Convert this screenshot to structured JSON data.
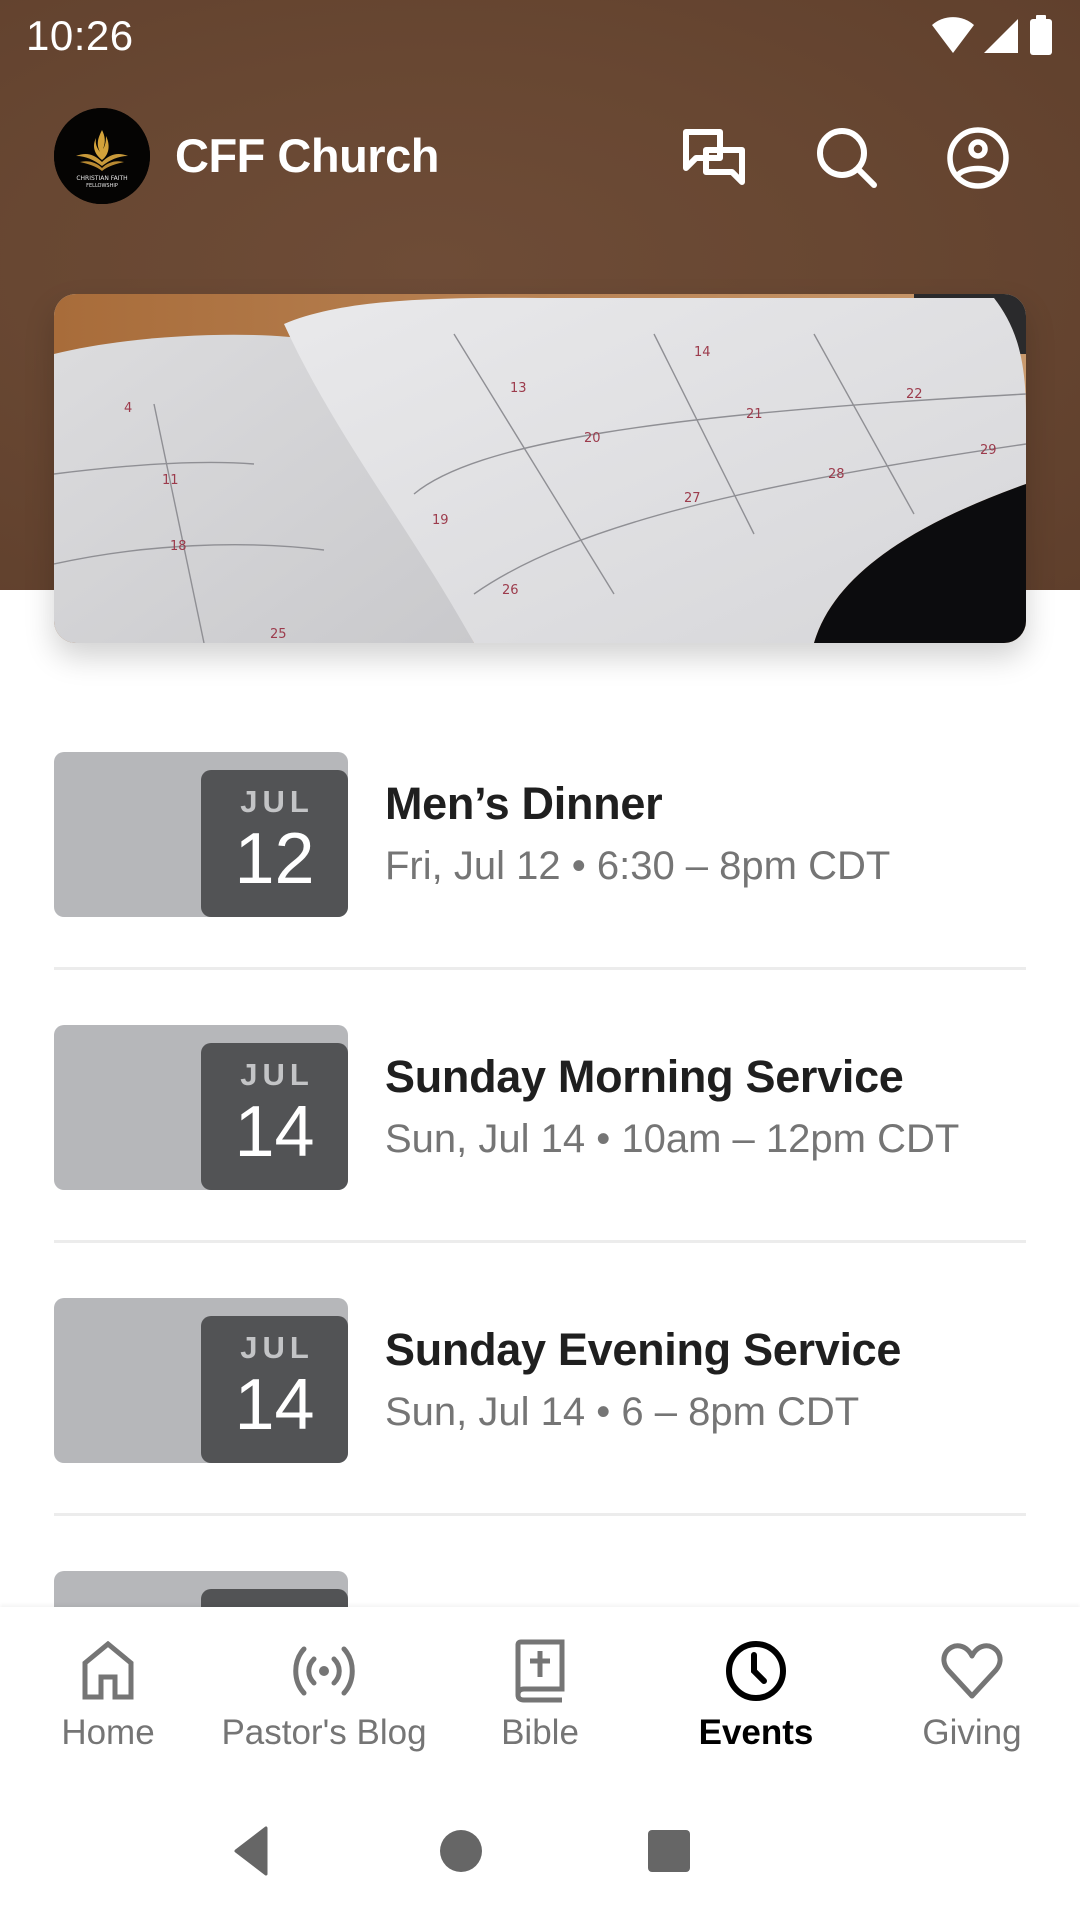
{
  "status_bar": {
    "time": "10:26",
    "icons": [
      "wifi-icon",
      "cellular-signal-icon",
      "battery-icon"
    ]
  },
  "app_bar": {
    "logo": {
      "icon": "christian-faith-fellowship-logo",
      "text_line1": "CHRISTIAN FAITH",
      "text_line2": "FELLOWSHIP"
    },
    "title": "CFF Church",
    "actions": [
      {
        "name": "chat",
        "icon": "chat-bubbles-icon"
      },
      {
        "name": "search",
        "icon": "search-icon"
      },
      {
        "name": "account",
        "icon": "account-circle-icon"
      }
    ]
  },
  "hero": {
    "description": "Open calendar planner book",
    "calendar_numbers": [
      "4",
      "11",
      "18",
      "25",
      "13",
      "20",
      "27",
      "14",
      "21",
      "28",
      "22",
      "29",
      "19",
      "26"
    ]
  },
  "events": [
    {
      "month": "JUL",
      "day": "12",
      "title": "Men’s Dinner",
      "time": "Fri, Jul 12 • 6:30 – 8pm CDT"
    },
    {
      "month": "JUL",
      "day": "14",
      "title": "Sunday Morning Service",
      "time": "Sun, Jul 14 • 10am – 12pm CDT"
    },
    {
      "month": "JUL",
      "day": "14",
      "title": "Sunday Evening Service",
      "time": "Sun, Jul 14 • 6 – 8pm CDT"
    }
  ],
  "bottom_nav": {
    "items": [
      {
        "label": "Home",
        "icon": "home-icon",
        "active": false
      },
      {
        "label": "Pastor's Blog",
        "icon": "broadcast-icon",
        "active": false
      },
      {
        "label": "Bible",
        "icon": "bible-icon",
        "active": false
      },
      {
        "label": "Events",
        "icon": "clock-icon",
        "active": true
      },
      {
        "label": "Giving",
        "icon": "heart-icon",
        "active": false
      }
    ]
  },
  "system_nav": {
    "buttons": [
      "back",
      "home",
      "recents"
    ]
  },
  "colors": {
    "header_brown": "#684732",
    "badge_outer": "#b6b7ba",
    "badge_inner": "#525355",
    "title_text": "#1f1f1f",
    "secondary_text": "#757575",
    "active_nav": "#000000"
  }
}
